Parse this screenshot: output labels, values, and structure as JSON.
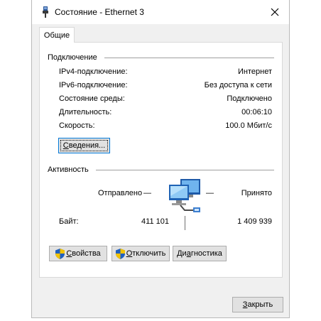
{
  "window": {
    "title": "Состояние - Ethernet 3",
    "close_glyph": "✕"
  },
  "tabs": [
    {
      "label": "Общие",
      "active": true
    }
  ],
  "connection": {
    "heading": "Подключение",
    "rows": [
      {
        "label": "IPv4-подключение:",
        "value": "Интернет"
      },
      {
        "label": "IPv6-подключение:",
        "value": "Без доступа к сети"
      },
      {
        "label": "Состояние среды:",
        "value": "Подключено"
      },
      {
        "label": "Длительность:",
        "value": "00:06:10"
      },
      {
        "label": "Скорость:",
        "value": "100.0 Мбит/с"
      }
    ],
    "details_button": {
      "mnemonic": "С",
      "rest": "ведения..."
    }
  },
  "activity": {
    "heading": "Активность",
    "sent_label": "Отправлено",
    "received_label": "Принято",
    "dash": "—",
    "bytes_label": "Байт:",
    "bytes_sent": "411 101",
    "bytes_received": "1 409 939",
    "icon": "network-computers-icon"
  },
  "actions": {
    "properties": {
      "mnemonic": "С",
      "rest": "войства"
    },
    "disable": {
      "mnemonic": "О",
      "rest": "тключить"
    },
    "diagnose": {
      "prefix": "Ди",
      "mnemonic": "а",
      "rest": "гностика"
    }
  },
  "footer": {
    "close_button": {
      "mnemonic": "З",
      "rest": "акрыть"
    }
  },
  "colors": {
    "accent": "#0078d7",
    "shield_blue": "#1f5fbf",
    "shield_yellow": "#f2c200"
  }
}
